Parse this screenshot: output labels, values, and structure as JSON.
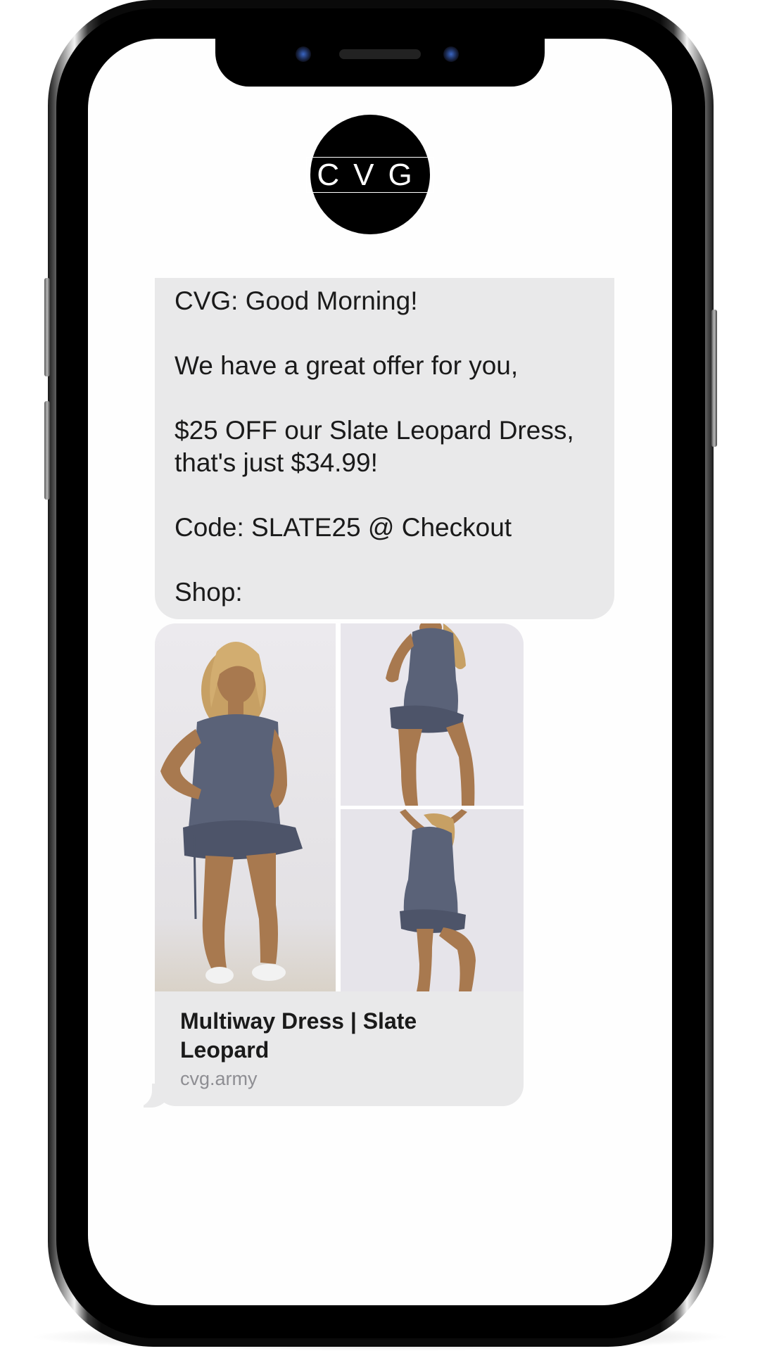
{
  "logo": {
    "text": "CVG"
  },
  "message": {
    "lines": [
      "CVG: Good Morning!",
      "",
      "We have a great offer for you,",
      "",
      "$25 OFF our Slate Leopard Dress,",
      "that's just $34.99!",
      "",
      "Code: SLATE25 @ Checkout",
      "",
      "Shop:"
    ]
  },
  "link_preview": {
    "title": "Multiway Dress | Slate Leopard",
    "domain": "cvg.army"
  },
  "colors": {
    "bubble": "#e9e9ea",
    "dress": "#5a6278",
    "domain_text": "#8e8e93"
  }
}
